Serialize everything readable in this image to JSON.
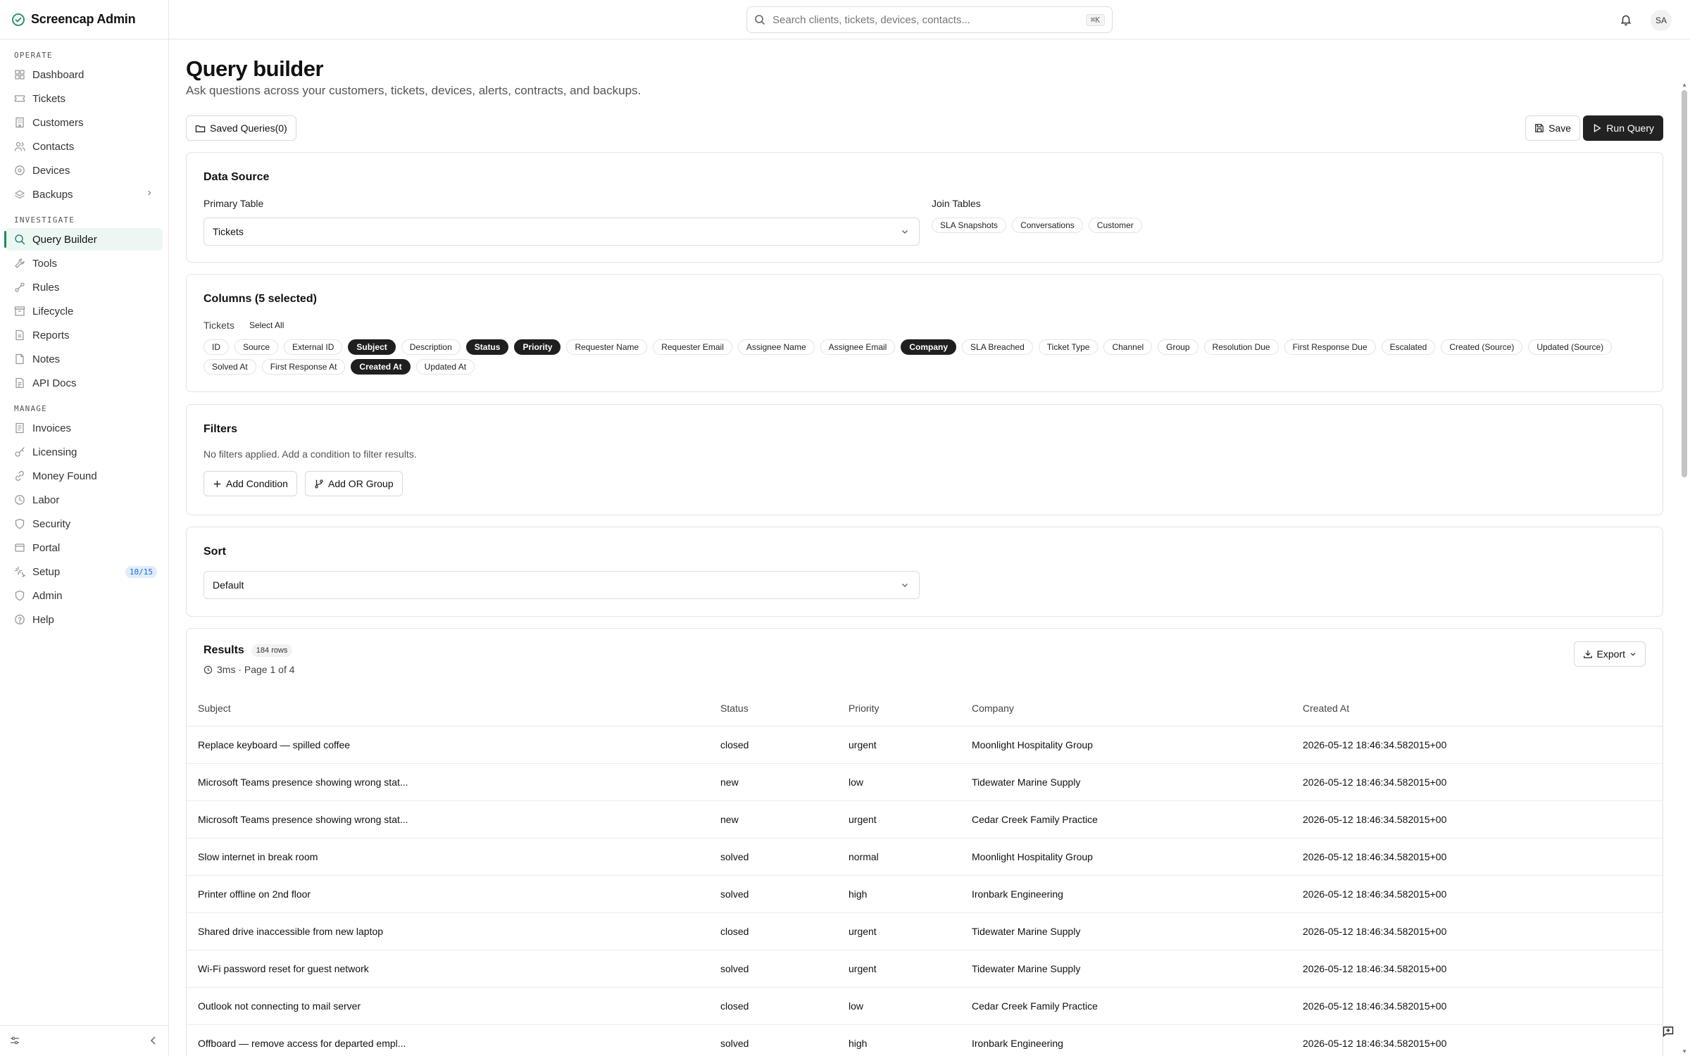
{
  "app": {
    "name": "Screencap Admin"
  },
  "sidebar": {
    "sections": [
      {
        "title": "OPERATE",
        "items": [
          {
            "label": "Dashboard",
            "icon": "grid-icon"
          },
          {
            "label": "Tickets",
            "icon": "ticket-icon"
          },
          {
            "label": "Customers",
            "icon": "building-icon"
          },
          {
            "label": "Contacts",
            "icon": "users-icon"
          },
          {
            "label": "Devices",
            "icon": "disc-icon"
          },
          {
            "label": "Backups",
            "icon": "backup-icon",
            "expandable": true
          }
        ]
      },
      {
        "title": "INVESTIGATE",
        "items": [
          {
            "label": "Query Builder",
            "icon": "search-icon",
            "active": true
          },
          {
            "label": "Tools",
            "icon": "wrench-icon"
          },
          {
            "label": "Rules",
            "icon": "rules-icon"
          },
          {
            "label": "Lifecycle",
            "icon": "lifecycle-icon"
          },
          {
            "label": "Reports",
            "icon": "reports-icon"
          },
          {
            "label": "Notes",
            "icon": "notes-icon"
          },
          {
            "label": "API Docs",
            "icon": "doc-icon"
          }
        ]
      },
      {
        "title": "MANAGE",
        "items": [
          {
            "label": "Invoices",
            "icon": "invoice-icon"
          },
          {
            "label": "Licensing",
            "icon": "key-icon"
          },
          {
            "label": "Money Found",
            "icon": "link-icon"
          },
          {
            "label": "Labor",
            "icon": "clock-icon"
          },
          {
            "label": "Security",
            "icon": "shield-icon"
          },
          {
            "label": "Portal",
            "icon": "portal-icon"
          },
          {
            "label": "Setup",
            "icon": "sparkle-icon",
            "badge": "10/15"
          },
          {
            "label": "Admin",
            "icon": "admin-shield-icon"
          },
          {
            "label": "Help",
            "icon": "help-icon"
          }
        ]
      }
    ]
  },
  "topbar": {
    "search_placeholder": "Search clients, tickets, devices, contacts...",
    "shortcut": "⌘K",
    "avatar_initials": "SA"
  },
  "page": {
    "title": "Query builder",
    "subtitle": "Ask questions across your customers, tickets, devices, alerts, contracts, and backups.",
    "saved_queries_label": "Saved Queries(0)",
    "save_label": "Save",
    "run_label": "Run Query"
  },
  "data_source": {
    "title": "Data Source",
    "primary_label": "Primary Table",
    "primary_value": "Tickets",
    "join_label": "Join Tables",
    "joins": [
      "SLA Snapshots",
      "Conversations",
      "Customer"
    ]
  },
  "columns": {
    "title": "Columns (5 selected)",
    "table_label": "Tickets",
    "select_all": "Select All",
    "items": [
      {
        "label": "ID",
        "selected": false
      },
      {
        "label": "Source",
        "selected": false
      },
      {
        "label": "External ID",
        "selected": false
      },
      {
        "label": "Subject",
        "selected": true
      },
      {
        "label": "Description",
        "selected": false
      },
      {
        "label": "Status",
        "selected": true
      },
      {
        "label": "Priority",
        "selected": true
      },
      {
        "label": "Requester Name",
        "selected": false
      },
      {
        "label": "Requester Email",
        "selected": false
      },
      {
        "label": "Assignee Name",
        "selected": false
      },
      {
        "label": "Assignee Email",
        "selected": false
      },
      {
        "label": "Company",
        "selected": true
      },
      {
        "label": "SLA Breached",
        "selected": false
      },
      {
        "label": "Ticket Type",
        "selected": false
      },
      {
        "label": "Channel",
        "selected": false
      },
      {
        "label": "Group",
        "selected": false
      },
      {
        "label": "Resolution Due",
        "selected": false
      },
      {
        "label": "First Response Due",
        "selected": false
      },
      {
        "label": "Escalated",
        "selected": false
      },
      {
        "label": "Created (Source)",
        "selected": false
      },
      {
        "label": "Updated (Source)",
        "selected": false
      },
      {
        "label": "Solved At",
        "selected": false
      },
      {
        "label": "First Response At",
        "selected": false
      },
      {
        "label": "Created At",
        "selected": true
      },
      {
        "label": "Updated At",
        "selected": false
      }
    ]
  },
  "filters": {
    "title": "Filters",
    "empty_text": "No filters applied. Add a condition to filter results.",
    "add_condition": "Add Condition",
    "add_or_group": "Add OR Group"
  },
  "sort": {
    "title": "Sort",
    "value": "Default"
  },
  "results": {
    "title": "Results",
    "rows_badge": "184 rows",
    "meta": "3ms · Page 1 of 4",
    "export_label": "Export",
    "headers": [
      "Subject",
      "Status",
      "Priority",
      "Company",
      "Created At"
    ],
    "rows": [
      [
        "Replace keyboard — spilled coffee",
        "closed",
        "urgent",
        "Moonlight Hospitality Group",
        "2026-05-12 18:46:34.582015+00"
      ],
      [
        "Microsoft Teams presence showing wrong stat...",
        "new",
        "low",
        "Tidewater Marine Supply",
        "2026-05-12 18:46:34.582015+00"
      ],
      [
        "Microsoft Teams presence showing wrong stat...",
        "new",
        "urgent",
        "Cedar Creek Family Practice",
        "2026-05-12 18:46:34.582015+00"
      ],
      [
        "Slow internet in break room",
        "solved",
        "normal",
        "Moonlight Hospitality Group",
        "2026-05-12 18:46:34.582015+00"
      ],
      [
        "Printer offline on 2nd floor",
        "solved",
        "high",
        "Ironbark Engineering",
        "2026-05-12 18:46:34.582015+00"
      ],
      [
        "Shared drive inaccessible from new laptop",
        "closed",
        "urgent",
        "Tidewater Marine Supply",
        "2026-05-12 18:46:34.582015+00"
      ],
      [
        "Wi-Fi password reset for guest network",
        "solved",
        "urgent",
        "Tidewater Marine Supply",
        "2026-05-12 18:46:34.582015+00"
      ],
      [
        "Outlook not connecting to mail server",
        "closed",
        "low",
        "Cedar Creek Family Practice",
        "2026-05-12 18:46:34.582015+00"
      ],
      [
        "Offboard — remove access for departed empl...",
        "solved",
        "high",
        "Ironbark Engineering",
        "2026-05-12 18:46:34.582015+00"
      ]
    ]
  },
  "colors": {
    "accent": "#1b8e5a",
    "active_bg": "#edf7f2",
    "dark_button": "#222222",
    "badge_blue": "#2563eb"
  }
}
